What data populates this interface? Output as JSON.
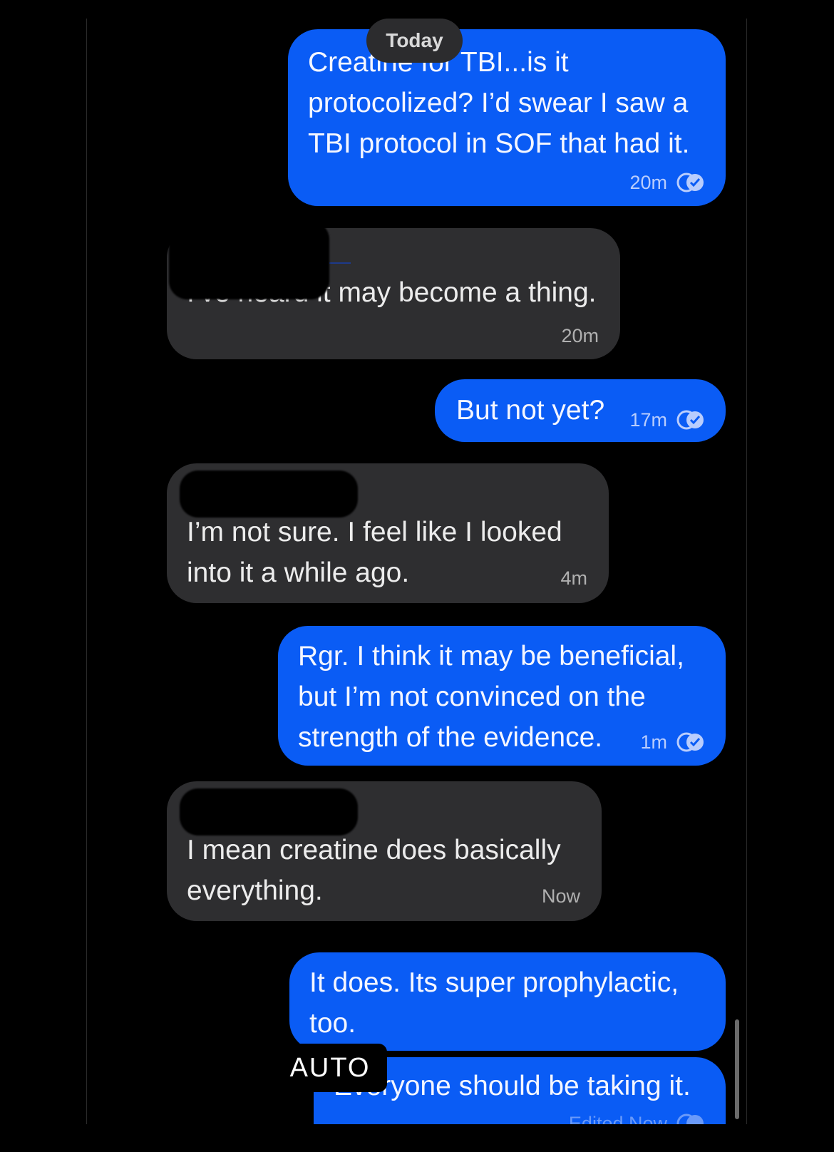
{
  "date_divider": "Today",
  "messages": [
    {
      "text": "Creatine for TBI...is it\nprotocolized? I’d swear I saw a\nTBI protocol in SOF that had it.",
      "time": "20m"
    },
    {
      "text": "I’ve heard it may become a thing.",
      "time": "20m"
    },
    {
      "text": "But not yet?",
      "time": "17m"
    },
    {
      "text": "I’m not sure.  I feel like I looked\ninto it a while ago.",
      "time": "4m"
    },
    {
      "text": "Rgr. I think it may be beneficial,\nbut I’m not convinced on the\nstrength of the evidence.",
      "time": "1m"
    },
    {
      "text": "I mean creatine does basically\neverything.",
      "time": "Now"
    },
    {
      "text": "It does. Its super prophylactic,\ntoo."
    },
    {
      "text": "Everyone should be taking it.",
      "time": "Edited  Now"
    }
  ],
  "overlay": {
    "auto_label": "AUTO"
  },
  "colors": {
    "outgoing": "#0a5cf5",
    "incoming": "#2e2e30",
    "background": "#000000"
  },
  "icons": {
    "read_receipt": "double-check-icon"
  }
}
